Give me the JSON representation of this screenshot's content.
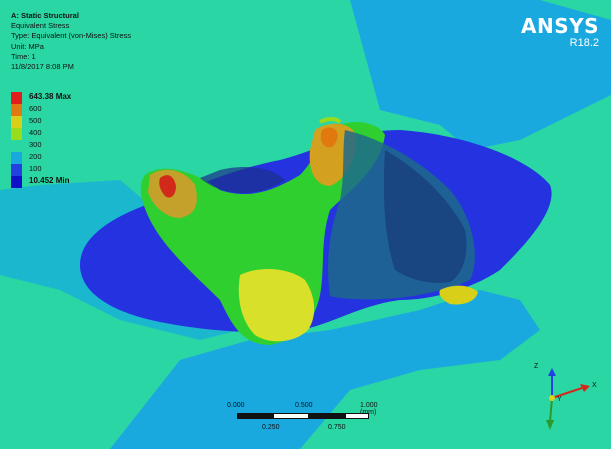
{
  "header": {
    "analysis": "A: Static Structural",
    "result": "Equivalent Stress",
    "type": "Type: Equivalent (von-Mises) Stress",
    "unit": "Unit: MPa",
    "time": "Time: 1",
    "date": "11/8/2017 8:08 PM"
  },
  "legend": {
    "max": "643.38 Max",
    "min": "10.452 Min",
    "levels": [
      {
        "label": "643.38 Max",
        "color": "#e01e1e"
      },
      {
        "label": "600",
        "color": "#e07a10"
      },
      {
        "label": "500",
        "color": "#d8cf18"
      },
      {
        "label": "400",
        "color": "#98dc1c"
      },
      {
        "label": "300",
        "color": "#2ad6a3"
      },
      {
        "label": "200",
        "color": "#1aa9df"
      },
      {
        "label": "100",
        "color": "#2540e0"
      },
      {
        "label": "10.452 Min",
        "color": "#1010c8"
      }
    ]
  },
  "brand": {
    "name": "ANSYS",
    "version": "R18.2"
  },
  "scale": {
    "labels_top": [
      "0.000",
      "0.500",
      "1.000 (mm)"
    ],
    "labels_bottom": [
      "0.250",
      "0.750"
    ]
  },
  "triad": {
    "x": "X",
    "y": "Y",
    "z": "Z"
  }
}
